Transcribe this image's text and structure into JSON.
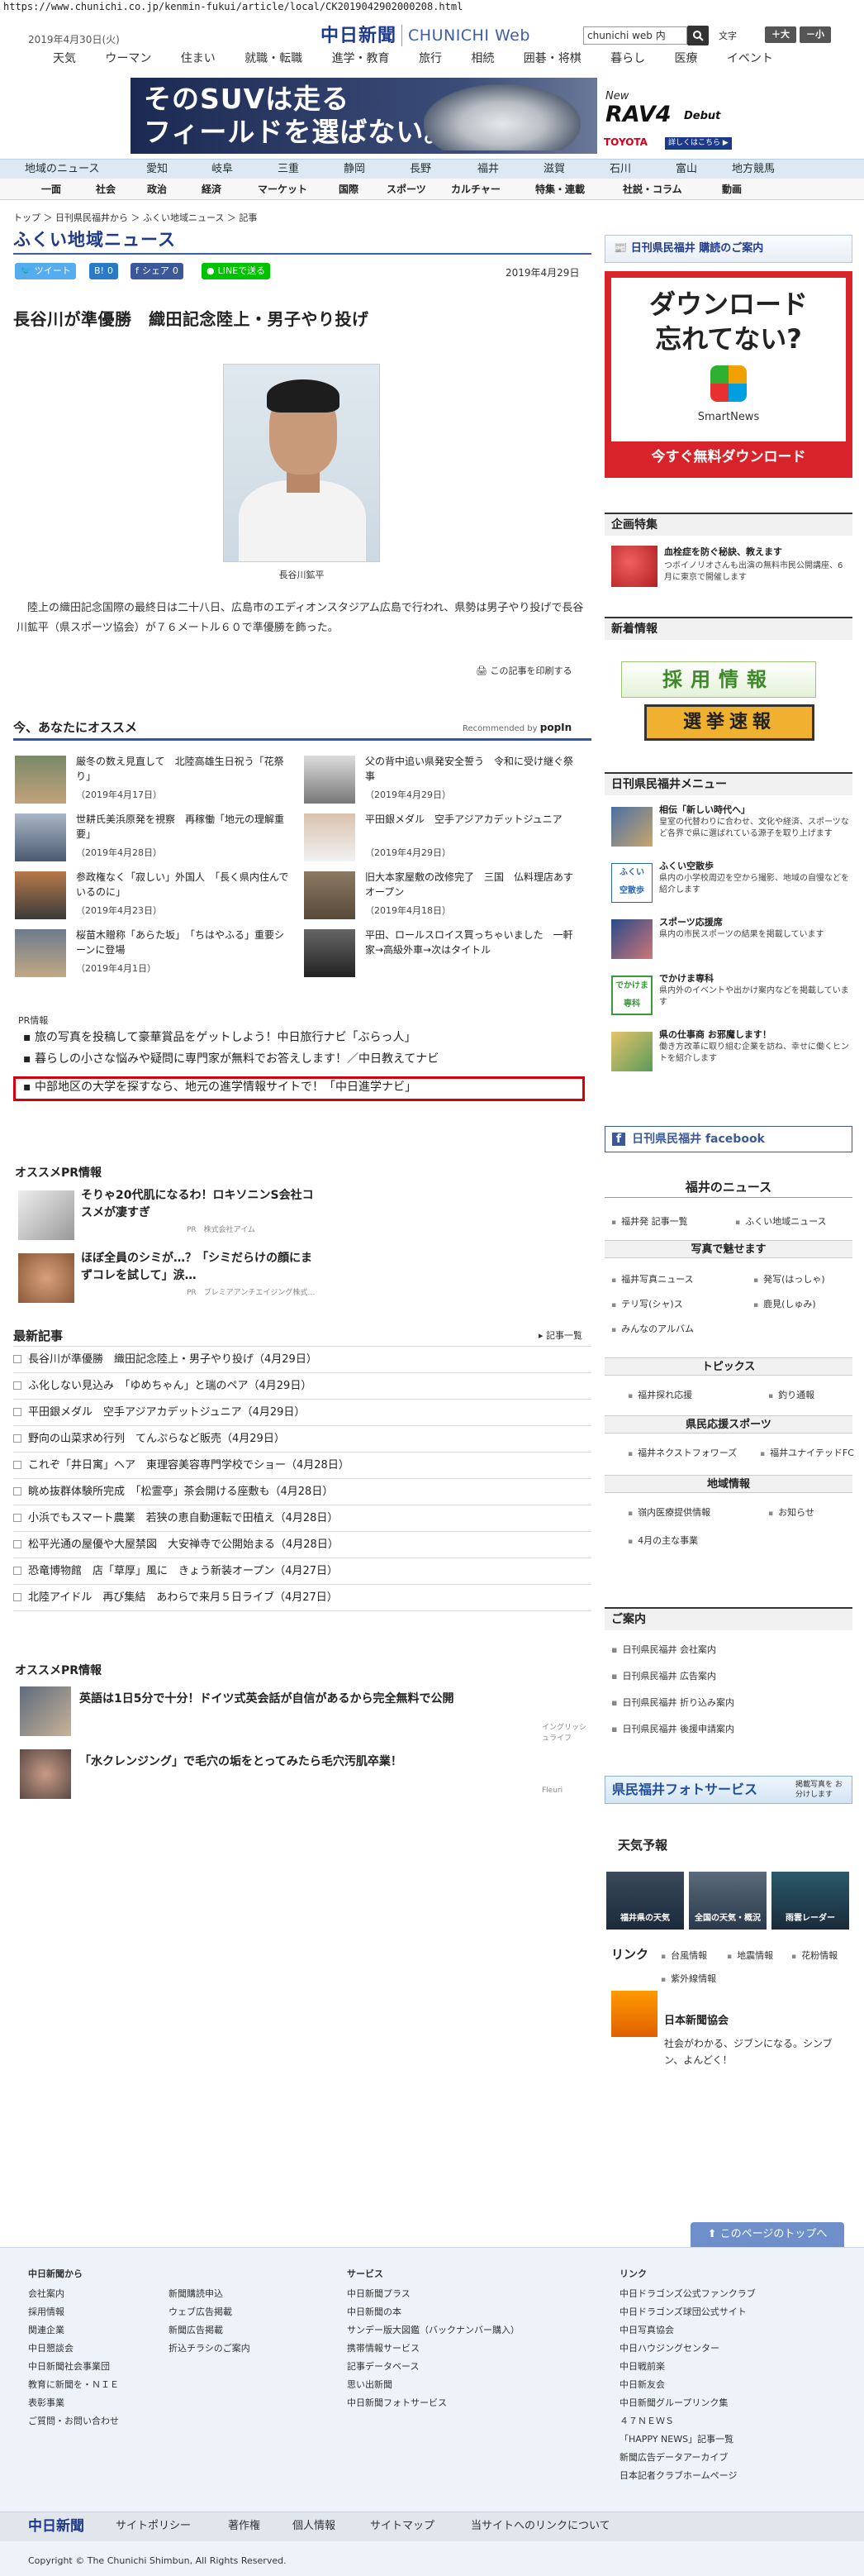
{
  "browser": {
    "url": "https://www.chunichi.co.jp/kenmin-fukui/article/local/CK2019042902000208.html"
  },
  "header": {
    "date": "2019年4月30日(火)",
    "logo_jp": "中日新聞",
    "logo_en": "CHUNICHI Web",
    "search_value": "chunichi web 内",
    "font_label": "文字",
    "font_plus": "＋大",
    "font_minus": "－小"
  },
  "global_nav": [
    "天気",
    "ウーマン",
    "住まい",
    "就職・転職",
    "進学・教育",
    "旅行",
    "相続",
    "囲碁・将棋",
    "暮らし",
    "医療",
    "イベント"
  ],
  "ad_banner": {
    "headline1": "そのSUVは走る",
    "headline2": "フィールドを選ばない。",
    "new": "New",
    "model": "RAV4",
    "debut": "Debut",
    "brand": "TOYOTA",
    "more": "詳しくはこちら ▶"
  },
  "region_nav": [
    "地域のニュース",
    "愛知",
    "岐阜",
    "三重",
    "静岡",
    "長野",
    "福井",
    "滋賀",
    "石川",
    "富山",
    "地方競馬"
  ],
  "category_nav": [
    "一面",
    "社会",
    "政治",
    "経済",
    "マーケット",
    "国際",
    "スポーツ",
    "カルチャー",
    "特集・連載",
    "社説・コラム",
    "動画"
  ],
  "breadcrumb": "トップ ＞ 日刊県民福井から ＞ ふくい地域ニュース ＞ 記事",
  "section_title": "ふくい地域ニュース",
  "share": {
    "tweet": "ツイート",
    "hatena": "B!",
    "hatena_count": "0",
    "fb_share": "シェア",
    "fb_count": "0",
    "line": "LINEで送る"
  },
  "article": {
    "date": "2019年4月29日",
    "headline": "長谷川が準優勝　織田記念陸上・男子やり投げ",
    "photo_caption": "長谷川鉱平",
    "body": "陸上の織田記念国際の最終日は二十八日、広島市のエディオンスタジアム広島で行われ、県勢は男子やり投げで長谷川鉱平（県スポーツ協会）が７６メートル６０で準優勝を飾った。",
    "print_label": "この記事を印刷する"
  },
  "recommend": {
    "heading": "今、あなたにオススメ",
    "by": "Recommended by",
    "brand": "popIn",
    "items": [
      {
        "title": "厳冬の数え見直して　北陸高雄生日祝う「花祭り」",
        "date": "（2019年4月17日）"
      },
      {
        "title": "父の背中追い県発安全誓う　令和に受け継ぐ祭事",
        "date": "（2019年4月29日）"
      },
      {
        "title": "世耕氏美浜原発を視察　再稼働「地元の理解重要」",
        "date": "（2019年4月28日）"
      },
      {
        "title": "平田銀メダル　空手アジアカデットジュニア",
        "date": "（2019年4月29日）"
      },
      {
        "title": "参政権なく「寂しい」外国人　「長く県内住んでいるのに」",
        "date": "（2019年4月23日）"
      },
      {
        "title": "旧大本家屋敷の改修完了　三国　仏料理店あすオープン",
        "date": "（2019年4月18日）"
      },
      {
        "title": "桜苗木贈称「あらた坂」　「ちはやふる」重要シーンに登場",
        "date": "（2019年4月1日）"
      },
      {
        "title": "平田、ロールスロイス買っちゃいました　一軒家→高級外車→次はタイトル",
        "date": ""
      }
    ]
  },
  "pr_info": {
    "label": "PR情報",
    "links": [
      "旅の写真を投稿して豪華賞品をゲットしよう！中日旅行ナビ「ぶらっ人」",
      "暮らしの小さな悩みや疑問に専門家が無料でお答えします！／中日教えてナビ",
      "中部地区の大学を探すなら、地元の進学情報サイトで！「中日進学ナビ」"
    ]
  },
  "osusume_pr": {
    "heading": "オススメPR情報",
    "items": [
      {
        "title": "そりゃ20代肌になるわ！ロキソニンS会社コスメが凄すぎ",
        "sponsor": "PR　株式会社アイム"
      },
      {
        "title": "ほぼ全員のシミが…？「シミだらけの顔にまずコレを試して」涙…",
        "sponsor": "PR　プレミアアンチエイジング株式…"
      }
    ]
  },
  "latest": {
    "heading": "最新記事",
    "more": "記事一覧",
    "items": [
      "長谷川が準優勝　織田記念陸上・男子やり投げ（4月29日）",
      "ふ化しない見込み　「ゆめちゃん」と瑞のペア（4月29日）",
      "平田銀メダル　空手アジアカデットジュニア（4月29日）",
      "野向の山菜求め行列　てんぷらなど販売（4月29日）",
      "これぞ「井日寓」ヘア　東理容美容専門学校でショー（4月28日）",
      "眺め抜群体験所完成　「松霊亭」茶会開ける座敷も（4月28日）",
      "小浜でもスマート農業　若狭の恵自動運転で田植え（4月28日）",
      "松平光通の屋優や大屋禁図　大安禅寺で公開始まる（4月28日）",
      "恐竜博物館　店「草厚」風に　きょう新装オープン（4月27日）",
      "北陸アイドル　再び集結　あわらで来月５日ライブ（4月27日）"
    ]
  },
  "osusume_pr2": {
    "heading": "オススメPR情報",
    "items": [
      {
        "title": "英語は1日5分で十分！ドイツ式英会話が自信があるから完全無料で公開",
        "sponsor": "イングリッシュライフ"
      },
      {
        "title": "「水クレンジング」で毛穴の垢をとってみたら毛穴汚肌卒業！",
        "sponsor": "Fleuri"
      }
    ]
  },
  "right": {
    "subscribe": "日刊県民福井 購読のご案内",
    "ad_line1": "ダウンロード",
    "ad_line2": "忘れてない?",
    "ad_app": "SmartNews",
    "ad_cta": "今すぐ無料ダウンロード",
    "kikaku_heading": "企画特集",
    "kikaku_title": "血栓症を防ぐ秘訣、教えます",
    "kikaku_desc": "つボイノリオさんも出演の無料市民公開講座、6月に東京で開催します",
    "shinchaku_heading": "新着情報",
    "saiyo": "採用情報",
    "senkyo": "選挙速報",
    "menu_heading": "日刊県民福井メニュー",
    "menu": [
      {
        "title": "相伝「新しい時代へ」",
        "desc": "皇室の代替わりに合わせ、文化や経済、スポーツなど各界で県に選ばれている源子を取り上げます"
      },
      {
        "title": "ふくい空散歩",
        "desc": "県内の小学校周辺を空から撮影、地域の自慢などを紹介します"
      },
      {
        "title": "スポーツ応援席",
        "desc": "県内の市民スポーツの結果を掲載しています"
      },
      {
        "title": "でかけま専科",
        "desc": "県内外のイベントや出かけ案内などを掲載しています"
      },
      {
        "title": "県の仕事商 お邪魔します！",
        "desc": "働き方改革に取り組む企業を訪ね、幸せに働くヒントを紹介します"
      }
    ],
    "facebook": "日刊県民福井 facebook",
    "fukui_news_heading": "福井のニュース",
    "fukui_news": [
      "福井発 記事一覧",
      "ふくい地域ニュース"
    ],
    "photo_heading": "写真で魅せます",
    "photo_links": [
      "福井写真ニュース",
      "発写(はっしゃ)",
      "テリ写(シャ)ス",
      "鹿見(しゅみ)",
      "みんなのアルバム"
    ],
    "topics_heading": "トピックス",
    "topics_links": [
      "福井探れ応援",
      "釣り通報"
    ],
    "sports_heading": "県民応援スポーツ",
    "sports_links": [
      "福井ネクストフォワーズ",
      "福井ユナイテッドFC"
    ],
    "area_heading": "地域情報",
    "area_links": [
      "嶺内医療提供情報",
      "お知らせ",
      "4月の主な事業"
    ],
    "annai_heading": "ご案内",
    "annai_links": [
      "日刊県民福井 会社案内",
      "日刊県民福井 広告案内",
      "日刊県民福井 折り込み案内",
      "日刊県民福井 後援申請案内"
    ],
    "photo_service": "県民福井フォトサービス",
    "photo_service_sub": "掲載写真を お分けします",
    "weather_heading": "天気予報",
    "weather": [
      "福井県の天気",
      "全国の天気・概況",
      "雨雲レーダー"
    ],
    "link_heading": "リンク",
    "link_items": [
      "台風情報",
      "地震情報",
      "花粉情報",
      "紫外線情報"
    ],
    "nsk_title": "日本新聞協会",
    "nsk_desc": "社会がわかる、ジブンになる。シンブン、よんどく！"
  },
  "footer": {
    "totop": "このページのトップへ",
    "col1_h": "中日新聞から",
    "col1": [
      "会社案内",
      "採用情報",
      "関連企業",
      "中日懇談会",
      "中日新聞社会事業団",
      "教育に新聞を・ＮＩＥ",
      "表彰事業",
      "ご質問・お問い合わせ"
    ],
    "col2": [
      "新聞購読申込",
      "ウェブ広告掲載",
      "新聞広告掲載",
      "折込チラシのご案内"
    ],
    "col3_h": "サービス",
    "col3": [
      "中日新聞プラス",
      "中日新聞の本",
      "サンデー版大図鑑（バックナンバー購入）",
      "携帯情報サービス",
      "記事データベース",
      "思い出新聞",
      "中日新聞フォトサービス"
    ],
    "col4_h": "リンク",
    "col4": [
      "中日ドラゴンズ公式ファンクラブ",
      "中日ドラゴンズ球団公式サイト",
      "中日写真協会",
      "中日ハウジングセンター",
      "中日戦前楽",
      "中日新友会",
      "中日新聞グループリンク集",
      "４７ＮＥＷＳ",
      "「HAPPY NEWS」記事一覧",
      "新聞広告データアーカイブ",
      "日本記者クラブホームページ"
    ],
    "bar_logo": "中日新聞",
    "bar": [
      "サイトポリシー",
      "著作権",
      "個人情報",
      "サイトマップ",
      "当サイトへのリンクについて"
    ],
    "copyright": "Copyright © The Chunichi Shimbun, All Rights Reserved."
  }
}
